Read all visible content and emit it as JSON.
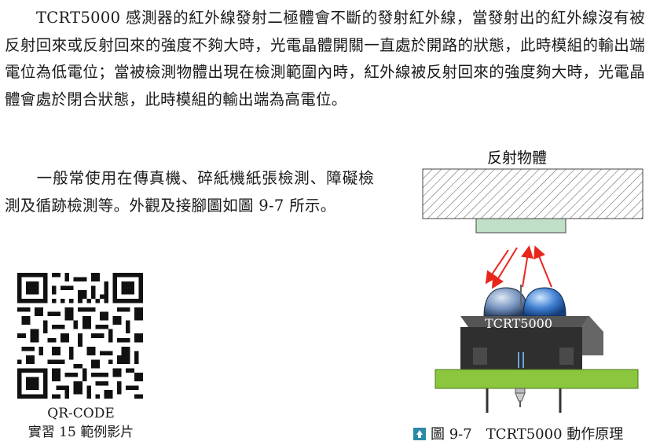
{
  "paragraph1": "TCRT5000 感測器的紅外線發射二極體會不斷的發射紅外線，當發射出的紅外線沒有被反射回來或反射回來的強度不夠大時，光電晶體開關一直處於開路的狀態，此時模組的輸出端電位為低電位；當被檢測物體出現在檢測範圍內時，紅外線被反射回來的強度夠大時，光電晶體會處於閉合狀態，此時模組的輸出端為高電位。",
  "paragraph2": "一般常使用在傳真機、碎紙機紙張檢測、障礙檢測及循跡檢測等。外觀及接腳圖如圖 9-7 所示。",
  "qr": {
    "caption_line1": "QR-CODE",
    "caption_line2": "實習 15 範例影片"
  },
  "figure": {
    "object_label": "反射物體",
    "sensor_label": "TCRT5000",
    "caption": "圖 9-7　TCRT5000 動作原理",
    "colors": {
      "arrow": "#e8261c",
      "pcb": "#8cc63f",
      "sensor_body": "#333333",
      "led": "#3b6fc4",
      "target": "#bfe0c6"
    }
  }
}
